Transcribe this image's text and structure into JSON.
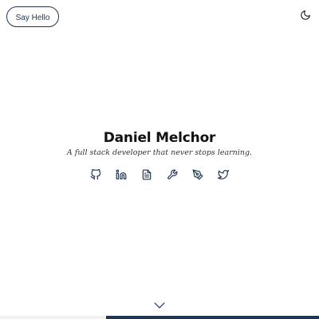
{
  "header": {
    "say_hello_label": "Say Hello",
    "theme_toggle_icon": "moon-icon"
  },
  "hero": {
    "name": "Daniel Melchor",
    "tagline": "A full stack developer that never stops learning."
  },
  "socials": [
    {
      "icon": "github-icon"
    },
    {
      "icon": "linkedin-icon"
    },
    {
      "icon": "document-icon"
    },
    {
      "icon": "wrench-icon"
    },
    {
      "icon": "pen-icon"
    },
    {
      "icon": "twitter-icon"
    }
  ],
  "scroll": {
    "icon": "chevron-down-icon"
  },
  "colors": {
    "accent": "#1f3550",
    "text": "#111111",
    "background": "#ffffff"
  }
}
